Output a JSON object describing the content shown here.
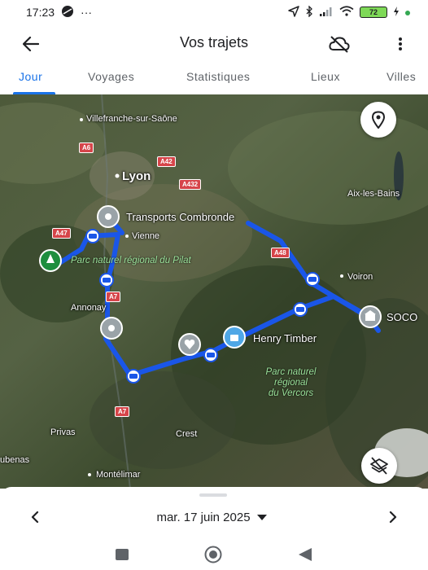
{
  "status_bar": {
    "time": "17:23",
    "dots": "···",
    "battery": "72"
  },
  "app_bar": {
    "title": "Vos trajets"
  },
  "tabs": [
    {
      "label": "Jour",
      "active": true
    },
    {
      "label": "Voyages",
      "active": false
    },
    {
      "label": "Statistiques",
      "active": false
    },
    {
      "label": "Lieux",
      "active": false
    },
    {
      "label": "Villes",
      "active": false
    }
  ],
  "map": {
    "places": {
      "villefranche": "Villefranche-sur-Saône",
      "lyon": "Lyon",
      "vienne": "Vienne",
      "annonay": "Annonay",
      "aix": "Aix-les-Bains",
      "voiron": "Voiron",
      "privas": "Privas",
      "crest": "Crest",
      "aubenas": "ubenas",
      "montelimar": "Montélimar"
    },
    "pois": {
      "transports": "Transports Combronde",
      "henry": "Henry Timber",
      "soco": "SOCO"
    },
    "parks": {
      "pilat": "Parc naturel régional du Pilat",
      "vercors_1": "Parc naturel",
      "vercors_2": "régional",
      "vercors_3": "du Vercors"
    },
    "roads": {
      "a6": "A6",
      "a42": "A42",
      "a432": "A432",
      "a47": "A47",
      "a48": "A48",
      "a7_north": "A7",
      "a7_south": "A7"
    },
    "route_color": "#1a56e8",
    "icons": {
      "location": "location-pin-icon",
      "layers": "layers-off-icon"
    }
  },
  "sheet": {
    "date": "mar. 17 juin 2025"
  }
}
